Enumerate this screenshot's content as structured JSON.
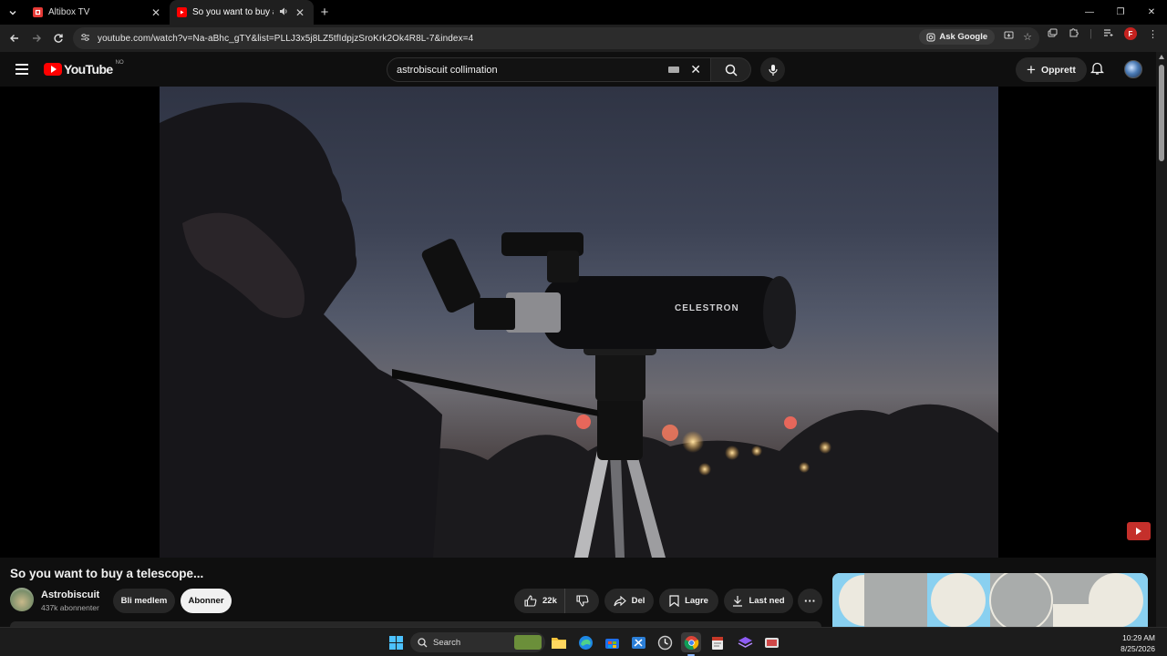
{
  "browser": {
    "tabs": [
      {
        "title": "Altibox TV",
        "active": false,
        "favicon_color": "#e53935"
      },
      {
        "title": "So you want to buy a telesc",
        "active": true,
        "favicon_color": "#ff0000",
        "audio": true
      }
    ],
    "url": "youtube.com/watch?v=Na-aBhc_gTY&list=PLLJ3x5j8LZ5tfIdpjzSroKrk2Ok4R8L-7&index=4",
    "ask_google_label": "Ask Google",
    "profile_initial": "F"
  },
  "youtube": {
    "logo_text": "YouTube",
    "region_code": "NO",
    "search": {
      "query": "astrobiscuit collimation"
    },
    "create_label": "Opprett"
  },
  "video": {
    "title": "So you want to buy a telescope...",
    "telescope_brand": "CELESTRON",
    "channel": {
      "name": "Astrobiscuit",
      "subscribers": "437k abonnenter"
    },
    "join_label": "Bli medlem",
    "subscribe_label": "Abonner",
    "likes": "22k",
    "share_label": "Del",
    "save_label": "Lagre",
    "download_label": "Last ned"
  },
  "taskbar": {
    "search_label": "Search",
    "time": "10:29 AM",
    "date": "8/25/2026"
  },
  "colors": {
    "accent_red": "#ff0000",
    "background": "#0f0f0f",
    "pill": "#272727"
  }
}
